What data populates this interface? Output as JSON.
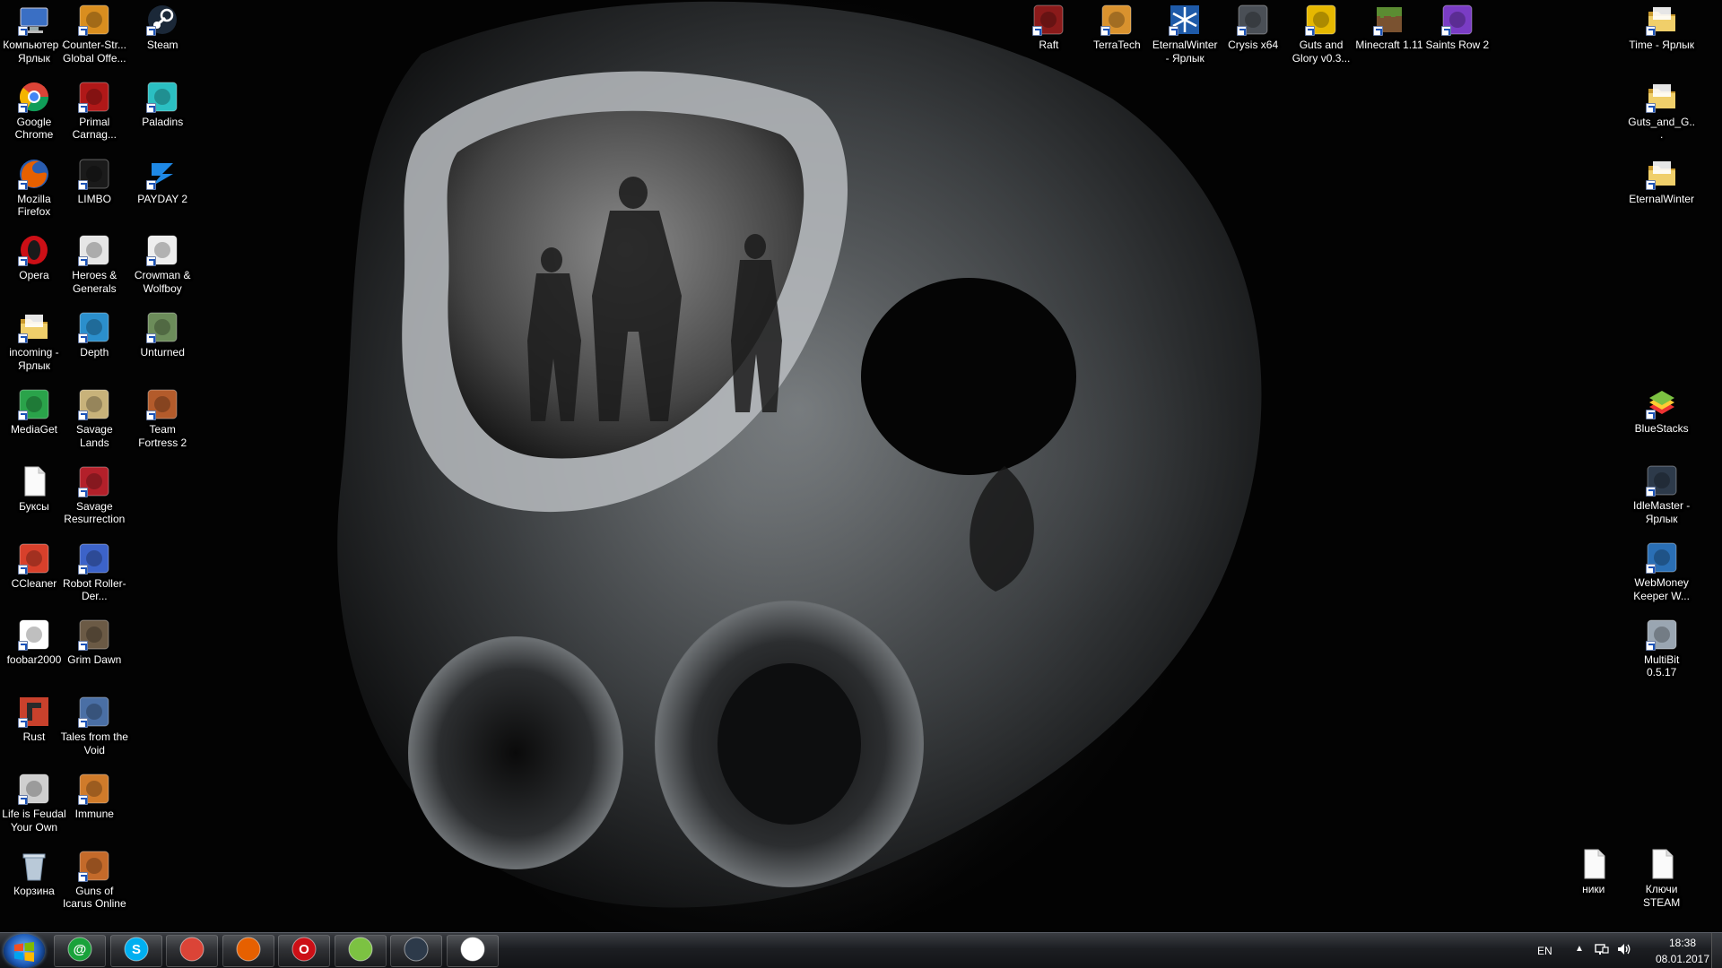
{
  "desktop": {
    "col1": [
      {
        "label": "Компьютер - Ярлык",
        "icon": "computer-icon",
        "color": "#3a6fc4"
      },
      {
        "label": "Google Chrome",
        "icon": "chrome-icon",
        "color": "#db4437"
      },
      {
        "label": "Mozilla Firefox",
        "icon": "firefox-icon",
        "color": "#e66000"
      },
      {
        "label": "Opera",
        "icon": "opera-icon",
        "color": "#cc0f16"
      },
      {
        "label": "incoming - Ярлык",
        "icon": "folder-icon",
        "color": "#e8c35a"
      },
      {
        "label": "MediaGet",
        "icon": "mediaget-icon",
        "color": "#2aa34a"
      },
      {
        "label": "Буксы",
        "icon": "document-icon",
        "color": "#f4f4f4"
      },
      {
        "label": "CCleaner",
        "icon": "ccleaner-icon",
        "color": "#d8402b"
      },
      {
        "label": "foobar2000",
        "icon": "foobar-icon",
        "color": "#ffffff"
      },
      {
        "label": "Rust",
        "icon": "rust-icon",
        "color": "#c9412c"
      },
      {
        "label": "Life is Feudal Your Own",
        "icon": "lif-icon",
        "color": "#cfcfcf"
      },
      {
        "label": "Корзина",
        "icon": "recycle-bin-icon",
        "color": "#9fb4c8"
      }
    ],
    "col2": [
      {
        "label": "Counter-Str... Global Offe...",
        "icon": "csgo-icon",
        "color": "#d98e1f"
      },
      {
        "label": "Primal Carnag...",
        "icon": "primal-carnage-icon",
        "color": "#b01818"
      },
      {
        "label": "LIMBO",
        "icon": "limbo-icon",
        "color": "#1a1a1a"
      },
      {
        "label": "Heroes & Generals",
        "icon": "heroes-generals-icon",
        "color": "#e6e6e6"
      },
      {
        "label": "Depth",
        "icon": "depth-icon",
        "color": "#2b8fcc"
      },
      {
        "label": "Savage Lands",
        "icon": "savage-lands-icon",
        "color": "#c8b27a"
      },
      {
        "label": "Savage Resurrection",
        "icon": "savage-resurrection-icon",
        "color": "#b3202a"
      },
      {
        "label": "Robot Roller-Der...",
        "icon": "robot-roller-icon",
        "color": "#3c63c9"
      },
      {
        "label": "Grim Dawn",
        "icon": "grim-dawn-icon",
        "color": "#6b5a45"
      },
      {
        "label": "Tales from the Void",
        "icon": "tales-void-icon",
        "color": "#4a6fa5"
      },
      {
        "label": "Immune",
        "icon": "immune-icon",
        "color": "#d07b2a"
      },
      {
        "label": "Guns of Icarus Online",
        "icon": "guns-icarus-icon",
        "color": "#c46a2a"
      }
    ],
    "col3": [
      {
        "label": "Steam",
        "icon": "steam-icon",
        "color": "#1b2838"
      },
      {
        "label": "Paladins",
        "icon": "paladins-icon",
        "color": "#2bbfc2"
      },
      {
        "label": "PAYDAY 2",
        "icon": "payday2-icon",
        "color": "#1e88e5"
      },
      {
        "label": "Crowman & Wolfboy",
        "icon": "crowman-icon",
        "color": "#eeeeee"
      },
      {
        "label": "Unturned",
        "icon": "unturned-icon",
        "color": "#6c8c5a"
      },
      {
        "label": "Team Fortress 2",
        "icon": "tf2-icon",
        "color": "#b35b2b"
      }
    ],
    "top": [
      {
        "label": "Raft",
        "icon": "raft-icon",
        "color": "#8a1a1a"
      },
      {
        "label": "TerraTech",
        "icon": "terratech-icon",
        "color": "#d9922e"
      },
      {
        "label": "EternalWinter - Ярлык",
        "icon": "eternalwinter-icon",
        "color": "#1e5aa8"
      },
      {
        "label": "Crysis x64",
        "icon": "crysis-icon",
        "color": "#4a4f56"
      },
      {
        "label": "Guts and Glory v0.3...",
        "icon": "guts-glory-icon",
        "color": "#e6b800"
      },
      {
        "label": "Minecraft 1.11",
        "icon": "minecraft-icon",
        "color": "#5b8c32"
      },
      {
        "label": "Saints Row 2",
        "icon": "saints-row-icon",
        "color": "#7a3cc4"
      }
    ],
    "right_top": [
      {
        "label": "Time - Ярлык",
        "icon": "folder-icon",
        "color": "#e8c35a"
      },
      {
        "label": "Guts_and_G...",
        "icon": "folder-icon",
        "color": "#e8c35a"
      },
      {
        "label": "EternalWinter",
        "icon": "folder-icon",
        "color": "#e8c35a"
      }
    ],
    "right_mid": [
      {
        "label": "BlueStacks",
        "icon": "bluestacks-icon",
        "color": "#7cc242"
      },
      {
        "label": "IdleMaster - Ярлык",
        "icon": "idlemaster-icon",
        "color": "#2d3a4a"
      },
      {
        "label": "WebMoney Keeper W...",
        "icon": "webmoney-icon",
        "color": "#2a6fb5"
      },
      {
        "label": "MultiBit 0.5.17",
        "icon": "multibit-icon",
        "color": "#9aa6b2"
      }
    ],
    "bottom_right": [
      {
        "label": "ники",
        "icon": "document-icon",
        "color": "#f4f4f4"
      },
      {
        "label": "Ключи STEAM",
        "icon": "document-icon",
        "color": "#f4f4f4"
      }
    ]
  },
  "taskbar": {
    "pinned": [
      {
        "name": "mail-agent-icon",
        "color": "#19a23a",
        "glyph": "@"
      },
      {
        "name": "skype-icon",
        "color": "#00aff0",
        "glyph": "S"
      },
      {
        "name": "chrome-icon",
        "color": "#db4437",
        "glyph": ""
      },
      {
        "name": "firefox-icon",
        "color": "#e66000",
        "glyph": ""
      },
      {
        "name": "opera-icon",
        "color": "#cc0f16",
        "glyph": "O"
      },
      {
        "name": "bluestacks-icon",
        "color": "#7cc242",
        "glyph": ""
      },
      {
        "name": "idlemaster-icon",
        "color": "#2d3a4a",
        "glyph": ""
      },
      {
        "name": "foobar-icon",
        "color": "#ffffff",
        "glyph": ""
      }
    ],
    "tray": {
      "lang": "EN",
      "time": "18:38",
      "date": "08.01.2017"
    }
  }
}
